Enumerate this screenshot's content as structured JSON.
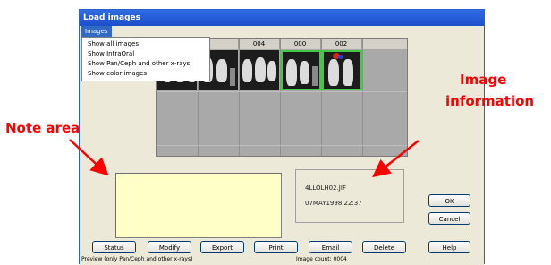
{
  "window": {
    "title": "Load images"
  },
  "menu": {
    "title": "Images",
    "items": [
      "Show all images",
      "Show IntraOral",
      "Show Pan/Ceph and other x-rays",
      "Show color images"
    ]
  },
  "grid": {
    "columns": [
      "004",
      "000",
      "002"
    ]
  },
  "info": {
    "filename": "4LLOLH02.JIF",
    "datetime": "07MAY1998 22:37"
  },
  "buttons": {
    "bottom": [
      "Status",
      "Modify",
      "Export",
      "Print",
      "Email",
      "Delete"
    ],
    "ok": "OK",
    "cancel": "Cancel",
    "help": "Help"
  },
  "status": {
    "left": "Preview (only Pan/Ceph and other x-rays)",
    "right": "Image count: 0004"
  },
  "annotations": {
    "note": "Note area",
    "image_info_1": "Image",
    "image_info_2": "information",
    "color": "#ff0000"
  }
}
